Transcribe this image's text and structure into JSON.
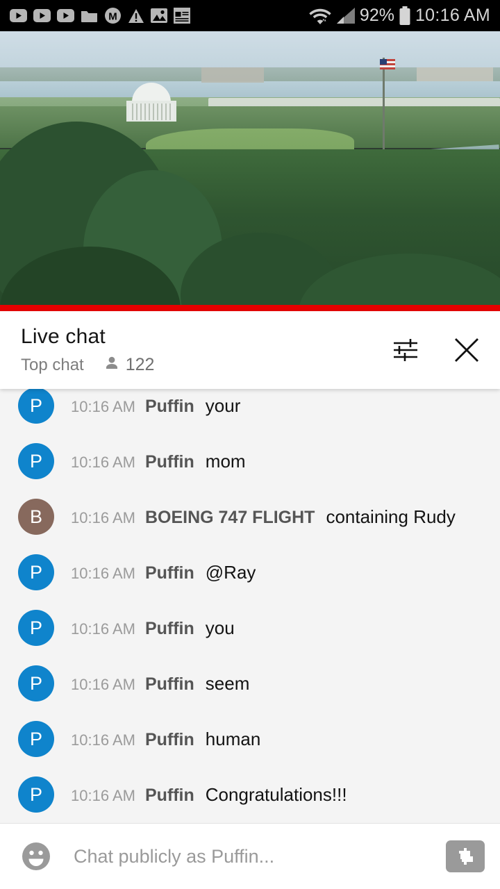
{
  "status_bar": {
    "left_icons": [
      {
        "name": "youtube-play-icon-1",
        "glyph": "play"
      },
      {
        "name": "youtube-play-icon-2",
        "glyph": "play"
      },
      {
        "name": "youtube-play-icon-3",
        "glyph": "play"
      },
      {
        "name": "folder-icon",
        "glyph": "folder"
      },
      {
        "name": "m-circle-icon",
        "glyph": "M"
      },
      {
        "name": "warning-triangle-icon",
        "glyph": "warning"
      },
      {
        "name": "image-icon",
        "glyph": "image"
      },
      {
        "name": "news-icon",
        "glyph": "news"
      }
    ],
    "wifi_icon": "wifi-data-icon",
    "signal_icon": "cellular-signal-icon",
    "battery_percent": "92%",
    "battery_icon": "battery-icon",
    "clock": "10:16 AM"
  },
  "video": {
    "name": "live-video-player",
    "description": "White House live stream",
    "progress_percent": 100,
    "progress_color": "#e60000"
  },
  "chat_header": {
    "title": "Live chat",
    "mode": "Top chat",
    "viewer_icon": "person-icon",
    "viewer_count": "122",
    "settings_icon": "tune-icon",
    "close_icon": "close-icon"
  },
  "messages": [
    {
      "avatar_letter": "P",
      "avatar_color": "#0f84cc",
      "time": "10:16 AM",
      "author": "Puffin",
      "text": "your"
    },
    {
      "avatar_letter": "P",
      "avatar_color": "#0f84cc",
      "time": "10:16 AM",
      "author": "Puffin",
      "text": "mom"
    },
    {
      "avatar_letter": "B",
      "avatar_color": "#87695d",
      "time": "10:16 AM",
      "author": "BOEING 747 FLIGHT",
      "text": "containing Rudy"
    },
    {
      "avatar_letter": "P",
      "avatar_color": "#0f84cc",
      "time": "10:16 AM",
      "author": "Puffin",
      "text": "@Ray"
    },
    {
      "avatar_letter": "P",
      "avatar_color": "#0f84cc",
      "time": "10:16 AM",
      "author": "Puffin",
      "text": "you"
    },
    {
      "avatar_letter": "P",
      "avatar_color": "#0f84cc",
      "time": "10:16 AM",
      "author": "Puffin",
      "text": "seem"
    },
    {
      "avatar_letter": "P",
      "avatar_color": "#0f84cc",
      "time": "10:16 AM",
      "author": "Puffin",
      "text": "human"
    },
    {
      "avatar_letter": "P",
      "avatar_color": "#0f84cc",
      "time": "10:16 AM",
      "author": "Puffin",
      "text": "Congratulations!!!"
    }
  ],
  "input_bar": {
    "emoji_icon": "emoji-smiley-icon",
    "placeholder": "Chat publicly as Puffin...",
    "value": "",
    "superchat_icon": "super-chat-dollar-icon"
  }
}
